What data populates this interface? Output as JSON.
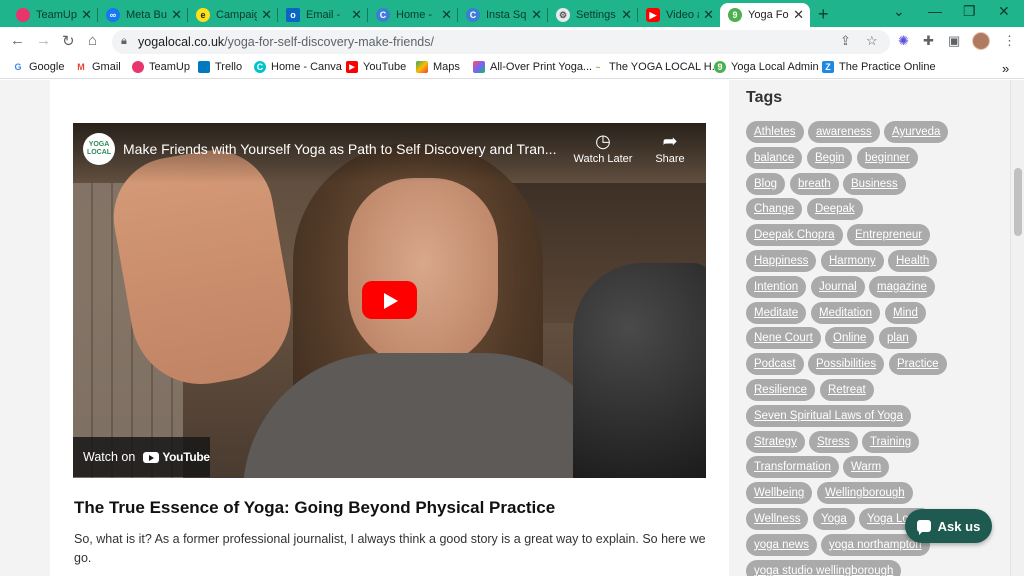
{
  "tabs": [
    {
      "title": "TeamUp",
      "color": "#e8356d"
    },
    {
      "title": "Meta Bu",
      "color": "#1877f2"
    },
    {
      "title": "Campaig",
      "color": "#ffe01b"
    },
    {
      "title": "Email - ",
      "color": "#0a66c2"
    },
    {
      "title": "Home - ",
      "color": "#3b7ed6"
    },
    {
      "title": "Insta Sq",
      "color": "#3b7ed6"
    },
    {
      "title": "Settings",
      "color": "#9aa0a6"
    },
    {
      "title": "Video ar",
      "color": "#ff0000"
    },
    {
      "title": "Yoga Fo",
      "color": "#4caf50",
      "active": true
    }
  ],
  "toolbar": {
    "url_domain": "yogalocal.co.uk",
    "url_path": "/yoga-for-self-discovery-make-friends/"
  },
  "bookmarks": [
    {
      "label": "Google",
      "color": "#4285f4",
      "glyph": "G"
    },
    {
      "label": "Gmail",
      "color": "#ea4335",
      "glyph": "M"
    },
    {
      "label": "TeamUp",
      "color": "#e8356d",
      "glyph": ""
    },
    {
      "label": "Trello",
      "color": "#0079bf",
      "glyph": ""
    },
    {
      "label": "Home - Canva",
      "color": "#00c4cc",
      "glyph": "C"
    },
    {
      "label": "YouTube",
      "color": "#ff0000",
      "glyph": "▶"
    },
    {
      "label": "Maps",
      "color": "#34a853",
      "glyph": ""
    },
    {
      "label": "All-Over Print Yoga...",
      "color": "#7b61ff",
      "glyph": ""
    },
    {
      "label": "The YOGA LOCAL H...",
      "color": "#7cb342",
      "glyph": ""
    },
    {
      "label": "Yoga Local Admin",
      "color": "#4caf50",
      "glyph": ""
    },
    {
      "label": "The Practice Online",
      "color": "#1e88e5",
      "glyph": ""
    }
  ],
  "video": {
    "title": "Make Friends with Yourself Yoga as Path to Self Discovery and Tran...",
    "channel_logo": "YOGA LOCAL",
    "watch_later": "Watch Later",
    "share": "Share",
    "watch_on": "Watch on",
    "youtube": "YouTube"
  },
  "article": {
    "heading": "The True Essence of Yoga: Going Beyond Physical Practice",
    "paragraph": "So, what is it? As a former professional journalist, I always think a good story is a great way to explain.  So here we go."
  },
  "sidebar": {
    "title": "Tags",
    "tags": [
      "Athletes",
      "awareness",
      "Ayurveda",
      "balance",
      "Begin",
      "beginner",
      "Blog",
      "breath",
      "Business",
      "Change",
      "Deepak",
      "Deepak Chopra",
      "Entrepreneur",
      "Happiness",
      "Harmony",
      "Health",
      "Intention",
      "Journal",
      "magazine",
      "Meditate",
      "Meditation",
      "Mind",
      "Nene Court",
      "Online",
      "plan",
      "Podcast",
      "Possibilities",
      "Practice",
      "Resilience",
      "Retreat",
      "Seven Spiritual Laws of Yoga",
      "Strategy",
      "Stress",
      "Training",
      "Transformation",
      "Warm",
      "Wellbeing",
      "Wellingborough",
      "Wellness",
      "Yoga",
      "Yoga Local",
      "yoga news",
      "yoga northampton",
      "yoga studio wellingborough"
    ]
  },
  "chat": {
    "label": "Ask us"
  }
}
